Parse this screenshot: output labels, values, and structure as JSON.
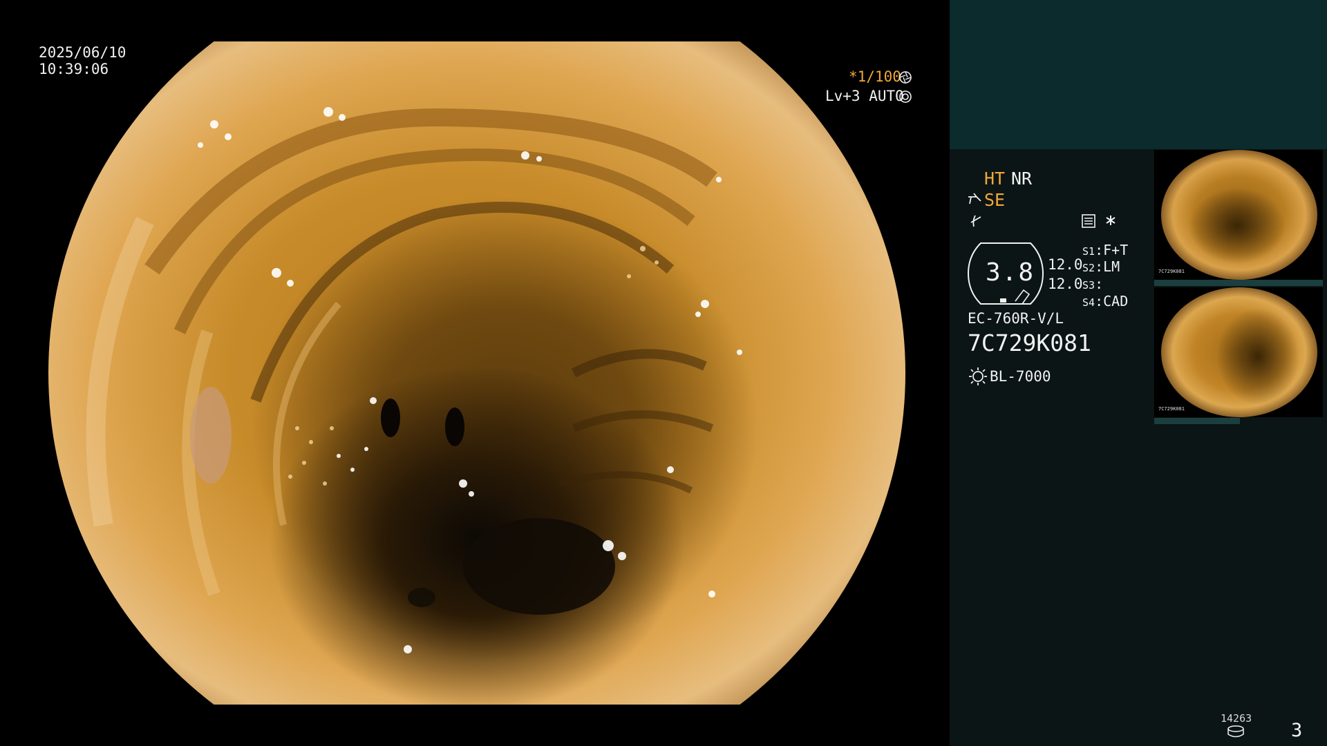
{
  "overlay": {
    "date": "2025/06/10",
    "time": "10:39:06",
    "shutter_speed": "*1/100",
    "level": "Lv+3 AUTO"
  },
  "status": {
    "ht": "HT",
    "nr": "NR",
    "se": "SE",
    "zoom": "3.8",
    "brightness_1": "12.0",
    "brightness_2": "12.0",
    "switches": [
      {
        "label": "S1",
        "value": "F+T"
      },
      {
        "label": "S2",
        "value": "LM"
      },
      {
        "label": "S3",
        "value": ""
      },
      {
        "label": "S4",
        "value": "CAD"
      }
    ],
    "scope_model": "EC-760R-V/L",
    "scope_serial": "7C729K081",
    "light_source": "BL-7000"
  },
  "thumbnails": [
    {
      "caption": "7C729K081"
    },
    {
      "caption": "7C729K081"
    }
  ],
  "footer": {
    "image_count": "14263",
    "page": "3"
  },
  "colors": {
    "accent_orange": "#f2a83a",
    "panel_top": "#0b2b2d",
    "panel_bg": "#0b1515"
  },
  "icons": {
    "shutter": "aperture-icon",
    "level": "auto-iris-icon",
    "structure": "structure-enhance-icon",
    "color": "color-mode-icon",
    "memory": "memory-card-icon",
    "light": "lamp-icon",
    "storage": "storage-icon"
  }
}
